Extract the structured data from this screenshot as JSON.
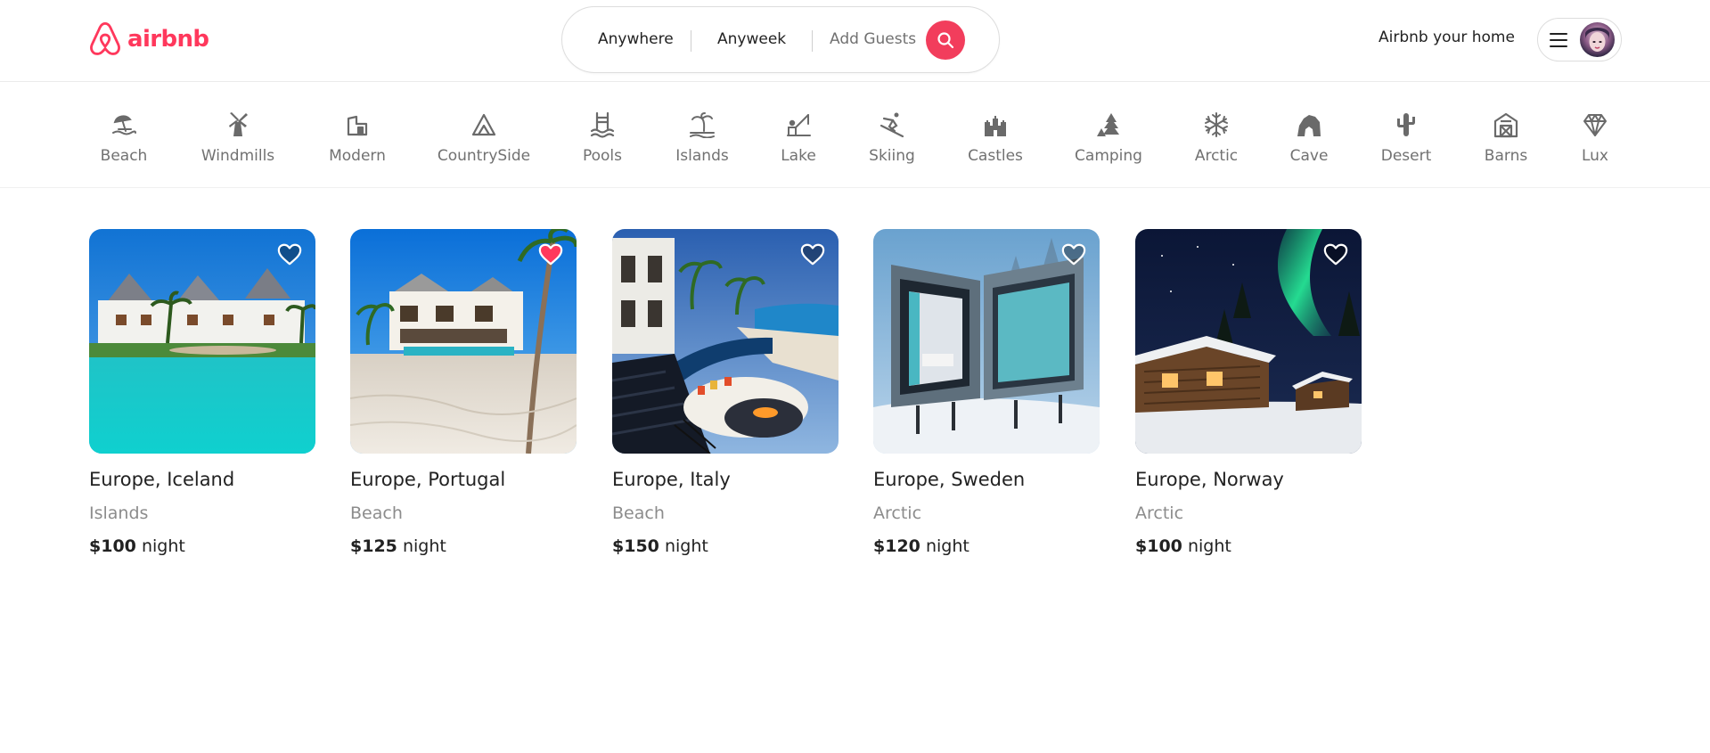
{
  "brand": {
    "name": "airbnb",
    "logo_icon": "airbnb-logo-icon",
    "color": "#ff385c"
  },
  "search": {
    "where": "Anywhere",
    "when": "Anyweek",
    "guests_placeholder": "Add Guests",
    "button_icon": "search-icon",
    "button_color": "#f23d5c"
  },
  "header": {
    "host_link": "Airbnb your home",
    "menu_icon": "hamburger-menu-icon",
    "avatar": "user-avatar"
  },
  "categories": [
    {
      "label": "Beach",
      "icon": "beach-umbrella-icon"
    },
    {
      "label": "Windmills",
      "icon": "windmill-icon"
    },
    {
      "label": "Modern",
      "icon": "modern-house-icon"
    },
    {
      "label": "CountrySide",
      "icon": "mountain-icon"
    },
    {
      "label": "Pools",
      "icon": "pool-ladder-icon"
    },
    {
      "label": "Islands",
      "icon": "palm-island-icon"
    },
    {
      "label": "Lake",
      "icon": "fishing-lake-icon"
    },
    {
      "label": "Skiing",
      "icon": "skier-icon"
    },
    {
      "label": "Castles",
      "icon": "castle-icon"
    },
    {
      "label": "Camping",
      "icon": "tent-tree-icon"
    },
    {
      "label": "Arctic",
      "icon": "snowflake-icon"
    },
    {
      "label": "Cave",
      "icon": "cave-icon"
    },
    {
      "label": "Desert",
      "icon": "cactus-icon"
    },
    {
      "label": "Barns",
      "icon": "barn-icon"
    },
    {
      "label": "Lux",
      "icon": "diamond-icon"
    }
  ],
  "listings": [
    {
      "location": "Europe, Iceland",
      "category": "Islands",
      "price": "$100",
      "unit": "night",
      "favorited": false,
      "image": "tropical-resort-beach-photo"
    },
    {
      "location": "Europe, Portugal",
      "category": "Beach",
      "price": "$125",
      "unit": "night",
      "favorited": true,
      "image": "beach-villa-pool-photo"
    },
    {
      "location": "Europe, Italy",
      "category": "Beach",
      "price": "$150",
      "unit": "night",
      "favorited": false,
      "image": "infinity-pool-firepit-photo"
    },
    {
      "location": "Europe, Sweden",
      "category": "Arctic",
      "price": "$120",
      "unit": "night",
      "favorited": false,
      "image": "snow-cabin-glass-photo"
    },
    {
      "location": "Europe, Norway",
      "category": "Arctic",
      "price": "$100",
      "unit": "night",
      "favorited": false,
      "image": "aurora-log-cabin-photo"
    }
  ]
}
